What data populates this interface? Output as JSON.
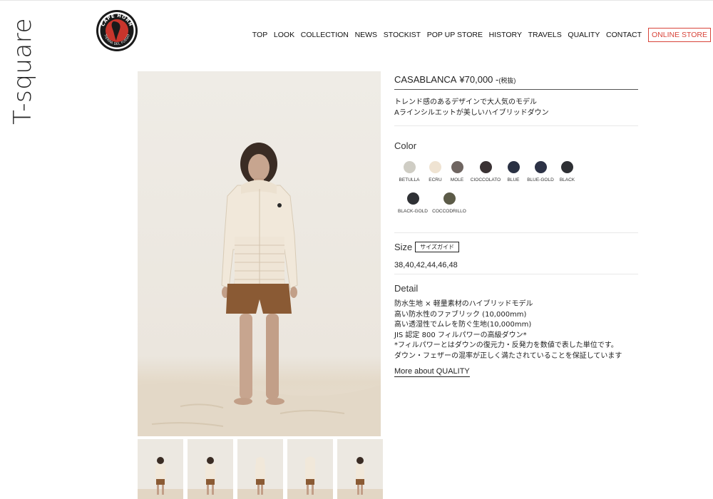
{
  "brand": {
    "name": "T-square",
    "logo_text_top": "CAPE HORN",
    "logo_text_bottom": "TIERRA DEL FUEGO"
  },
  "nav": {
    "items": [
      {
        "label": "TOP"
      },
      {
        "label": "LOOK"
      },
      {
        "label": "COLLECTION"
      },
      {
        "label": "NEWS"
      },
      {
        "label": "STOCKIST"
      },
      {
        "label": "POP UP STORE"
      },
      {
        "label": "HISTORY"
      },
      {
        "label": "TRAVELS"
      },
      {
        "label": "QUALITY"
      },
      {
        "label": "CONTACT"
      }
    ],
    "online_store": "ONLINE STORE"
  },
  "product": {
    "name": "CASABLANCA",
    "price": "¥70,000 -",
    "tax_note": "(税抜)",
    "description": [
      "トレンド感のあるデザインで大人気のモデル",
      "Aラインシルエットが美しいハイブリッドダウン"
    ],
    "color_label": "Color",
    "colors": [
      {
        "name": "BETULLA",
        "hex": "#cfcdc4"
      },
      {
        "name": "ECRU",
        "hex": "#efe3d2"
      },
      {
        "name": "MOLE",
        "hex": "#6f6561"
      },
      {
        "name": "CIOCCOLATO",
        "hex": "#3a3234"
      },
      {
        "name": "BLUE",
        "hex": "#2a3143"
      },
      {
        "name": "BLUE-GOLD",
        "hex": "#2c3246"
      },
      {
        "name": "BLACK",
        "hex": "#2e3034"
      },
      {
        "name": "BLACK-GOLD",
        "hex": "#2f3135"
      },
      {
        "name": "COCCODRILLO",
        "hex": "#5c5b48"
      }
    ],
    "size_label": "Size",
    "size_guide": "サイズガイド",
    "sizes": "38,40,42,44,46,48",
    "detail_label": "Detail",
    "details": [
      "防水生地 × 軽量素材のハイブリッドモデル",
      "高い防水性のファブリック (10,000mm)",
      "高い透湿性でムレを防ぐ生地(10,000mm)",
      "JIS 認定 800 フィルパワーの高級ダウン*",
      "*フィルパワーとはダウンの復元力・反発力を数値で表した単位です。",
      "ダウン・フェザーの混率が正しく満たされていることを保証しています"
    ],
    "more_link": "More about QUALITY"
  },
  "colors": {
    "accent_red": "#d8453a",
    "photo_bg": "#ede9e2",
    "sand": "#e6dccd"
  }
}
